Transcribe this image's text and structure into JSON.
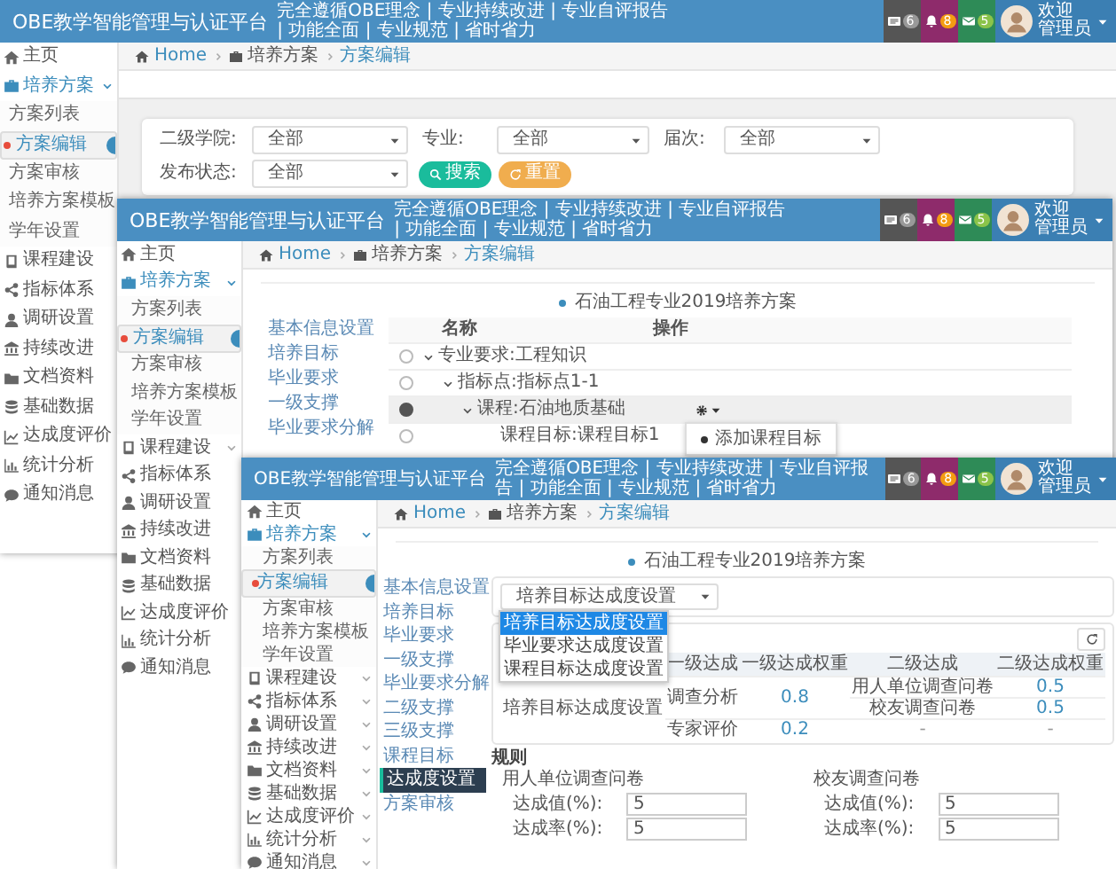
{
  "windows": [
    {
      "kind": "filter",
      "header": {
        "title": "OBE教学智能管理与认证平台",
        "tagline": "完全遵循OBE理念 | 专业持续改进 | 专业自评报告 | 功能全面 | 专业规范 | 省时省力",
        "badges": [
          "6",
          "8",
          "5"
        ],
        "user": [
          "欢迎",
          "管理员"
        ]
      },
      "sidebar": [
        {
          "label": "主页"
        },
        {
          "label": "培养方案",
          "expanded": true,
          "children": [
            {
              "label": "方案列表",
              "selected": false
            },
            {
              "label": "方案编辑",
              "selected": true
            },
            {
              "label": "方案审核",
              "selected": false
            },
            {
              "label": "培养方案模板",
              "selected": false
            },
            {
              "label": "学年设置",
              "selected": false
            }
          ]
        },
        {
          "label": "课程建设"
        },
        {
          "label": "指标体系"
        },
        {
          "label": "调研设置"
        },
        {
          "label": "持续改进"
        },
        {
          "label": "文档资料"
        },
        {
          "label": "基础数据"
        },
        {
          "label": "达成度评价"
        },
        {
          "label": "统计分析"
        },
        {
          "label": "通知消息"
        }
      ],
      "breadcrumb": [
        "Home",
        "培养方案",
        "方案编辑"
      ],
      "filters": [
        {
          "label": "二级学院:",
          "value": "全部"
        },
        {
          "label": "专业:",
          "value": "全部"
        },
        {
          "label": "届次:",
          "value": "全部"
        },
        {
          "label": "发布状态:",
          "value": "全部"
        }
      ],
      "buttons": [
        {
          "kind": "search",
          "label": "搜索"
        },
        {
          "kind": "reset",
          "label": "重置"
        }
      ]
    },
    {
      "kind": "tree",
      "header": {
        "title": "OBE教学智能管理与认证平台",
        "tagline": "完全遵循OBE理念 | 专业持续改进 | 专业自评报告 | 功能全面 | 专业规范 | 省时省力",
        "badges": [
          "6",
          "8",
          "5"
        ],
        "user": [
          "欢迎",
          "管理员"
        ]
      },
      "sidebar": [
        {
          "label": "主页"
        },
        {
          "label": "培养方案",
          "expanded": true,
          "children": [
            {
              "label": "方案列表",
              "selected": false
            },
            {
              "label": "方案编辑",
              "selected": true
            },
            {
              "label": "方案审核",
              "selected": false
            },
            {
              "label": "培养方案模板",
              "selected": false
            },
            {
              "label": "学年设置",
              "selected": false
            }
          ]
        },
        {
          "label": "课程建设",
          "expanded": false
        },
        {
          "label": "指标体系"
        },
        {
          "label": "调研设置"
        },
        {
          "label": "持续改进"
        },
        {
          "label": "文档资料"
        },
        {
          "label": "基础数据"
        },
        {
          "label": "达成度评价"
        },
        {
          "label": "统计分析"
        },
        {
          "label": "通知消息"
        }
      ],
      "breadcrumb": [
        "Home",
        "培养方案",
        "方案编辑"
      ],
      "plan_title": "石油工程专业2019培养方案",
      "tabs": [
        {
          "label": "基本信息设置",
          "selected": false
        },
        {
          "label": "培养目标",
          "selected": false
        },
        {
          "label": "毕业要求",
          "selected": false
        },
        {
          "label": "一级支撑",
          "selected": false
        },
        {
          "label": "毕业要求分解",
          "selected": false
        }
      ],
      "tree": {
        "columns": [
          "名称",
          "操作"
        ],
        "rows": [
          {
            "label": "专业要求:工程知识",
            "checked": false,
            "expanded": true,
            "children": [
              {
                "label": "指标点:指标点1-1",
                "checked": false,
                "expanded": true,
                "children": [
                  {
                    "label": "课程:石油地质基础",
                    "checked": true,
                    "expanded": true,
                    "actions": {
                      "open": true,
                      "items": [
                        "添加课程目标"
                      ]
                    },
                    "children": [
                      {
                        "label": "课程目标:课程目标1",
                        "checked": false
                      }
                    ]
                  }
                ]
              }
            ]
          }
        ]
      }
    },
    {
      "kind": "achievement",
      "header": {
        "title": "OBE教学智能管理与认证平台",
        "tagline": "完全遵循OBE理念 | 专业持续改进 | 专业自评报告 | 功能全面 | 专业规范 | 省时省力",
        "badges": [
          "6",
          "8",
          "5"
        ],
        "user": [
          "欢迎",
          "管理员"
        ]
      },
      "sidebar": [
        {
          "label": "主页"
        },
        {
          "label": "培养方案",
          "expanded": true,
          "children": [
            {
              "label": "方案列表",
              "selected": false
            },
            {
              "label": "方案编辑",
              "selected": true
            },
            {
              "label": "方案审核",
              "selected": false
            },
            {
              "label": "培养方案模板",
              "selected": false
            },
            {
              "label": "学年设置",
              "selected": false
            }
          ]
        },
        {
          "label": "课程建设",
          "expanded": false
        },
        {
          "label": "指标体系",
          "expanded": false
        },
        {
          "label": "调研设置",
          "expanded": false
        },
        {
          "label": "持续改进",
          "expanded": false
        },
        {
          "label": "文档资料",
          "expanded": false
        },
        {
          "label": "基础数据",
          "expanded": false
        },
        {
          "label": "达成度评价",
          "expanded": false
        },
        {
          "label": "统计分析",
          "expanded": false
        },
        {
          "label": "通知消息",
          "expanded": false
        }
      ],
      "breadcrumb": [
        "Home",
        "培养方案",
        "方案编辑"
      ],
      "plan_title": "石油工程专业2019培养方案",
      "tabs": [
        {
          "label": "基本信息设置",
          "selected": false
        },
        {
          "label": "培养目标",
          "selected": false
        },
        {
          "label": "毕业要求",
          "selected": false
        },
        {
          "label": "一级支撑",
          "selected": false
        },
        {
          "label": "毕业要求分解",
          "selected": false
        },
        {
          "label": "二级支撑",
          "selected": false
        },
        {
          "label": "三级支撑",
          "selected": false
        },
        {
          "label": "课程目标",
          "selected": false
        },
        {
          "label": "达成度设置",
          "selected": true
        },
        {
          "label": "方案审核",
          "selected": false
        }
      ],
      "select": {
        "value": "培养目标达成度设置",
        "open": true,
        "options": [
          {
            "label": "培养目标达成度设置",
            "selected": true
          },
          {
            "label": "毕业要求达成度设置",
            "selected": false
          },
          {
            "label": "课程目标达成度设置",
            "selected": false
          }
        ]
      },
      "table": {
        "columns": [
          "一级达成",
          "一级达成权重",
          "二级达成",
          "二级达成权重"
        ],
        "target": "培养目标达成度设置",
        "groups": [
          {
            "name": "调查分析",
            "weight": "0.8",
            "items": [
              {
                "name": "用人单位调查问卷",
                "weight": "0.5",
                "linked": true
              },
              {
                "name": "校友调查问卷",
                "weight": "0.5",
                "linked": true
              }
            ]
          },
          {
            "name": "专家评价",
            "weight": "0.2",
            "items": [
              {
                "name": "-",
                "weight": "-",
                "linked": false
              }
            ]
          }
        ]
      },
      "rules": {
        "title": "规则",
        "groups": [
          {
            "title": "用人单位调查问卷",
            "fields": [
              {
                "label": "达成值(%):",
                "value": "5"
              },
              {
                "label": "达成率(%):",
                "value": "5"
              }
            ]
          },
          {
            "title": "校友调查问卷",
            "fields": [
              {
                "label": "达成值(%):",
                "value": "5"
              },
              {
                "label": "达成率(%):",
                "value": "5"
              }
            ]
          }
        ]
      }
    }
  ]
}
